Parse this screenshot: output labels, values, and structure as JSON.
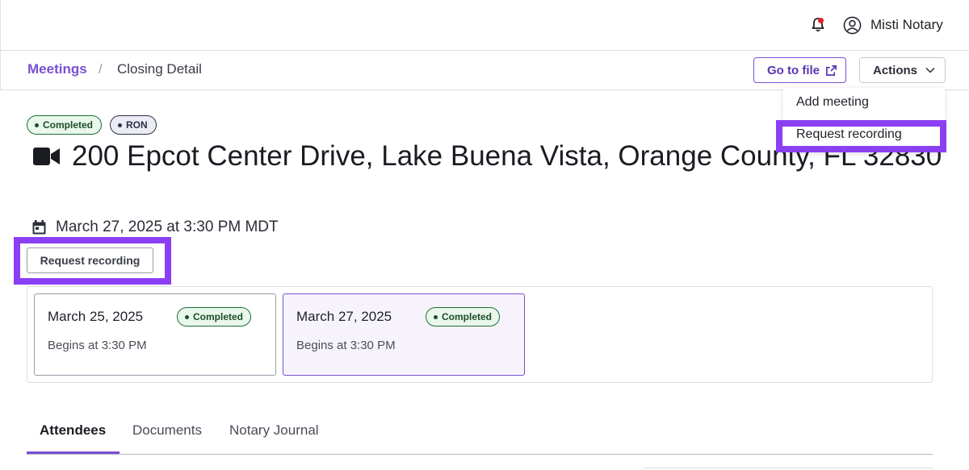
{
  "header": {
    "user_name": "Misti Notary",
    "notification_indicator": true
  },
  "breadcrumb": {
    "parent": "Meetings",
    "separator": "/",
    "current": "Closing Detail"
  },
  "toolbar": {
    "go_to_file_label": "Go to file",
    "actions_label": "Actions"
  },
  "actions_menu": {
    "items": [
      "Add meeting",
      "Request recording"
    ]
  },
  "meeting": {
    "status_badge": "Completed",
    "type_badge": "RON",
    "address": "200 Epcot Center Drive, Lake Buena Vista, Orange County, FL 32830",
    "datetime": "March 27, 2025 at 3:30 PM MDT",
    "request_recording_label": "Request recording"
  },
  "sessions": [
    {
      "date": "March 25, 2025",
      "status": "Completed",
      "begins": "Begins at 3:30 PM",
      "selected": false
    },
    {
      "date": "March 27, 2025",
      "status": "Completed",
      "begins": "Begins at 3:30 PM",
      "selected": true
    }
  ],
  "tabs": [
    {
      "label": "Attendees",
      "active": true
    },
    {
      "label": "Documents",
      "active": false
    },
    {
      "label": "Notary Journal",
      "active": false
    }
  ],
  "colors": {
    "accent": "#7a4fd3",
    "highlight": "#8b3ff2",
    "success_bg": "#e9f7ec",
    "success_text": "#1d4d2a"
  }
}
